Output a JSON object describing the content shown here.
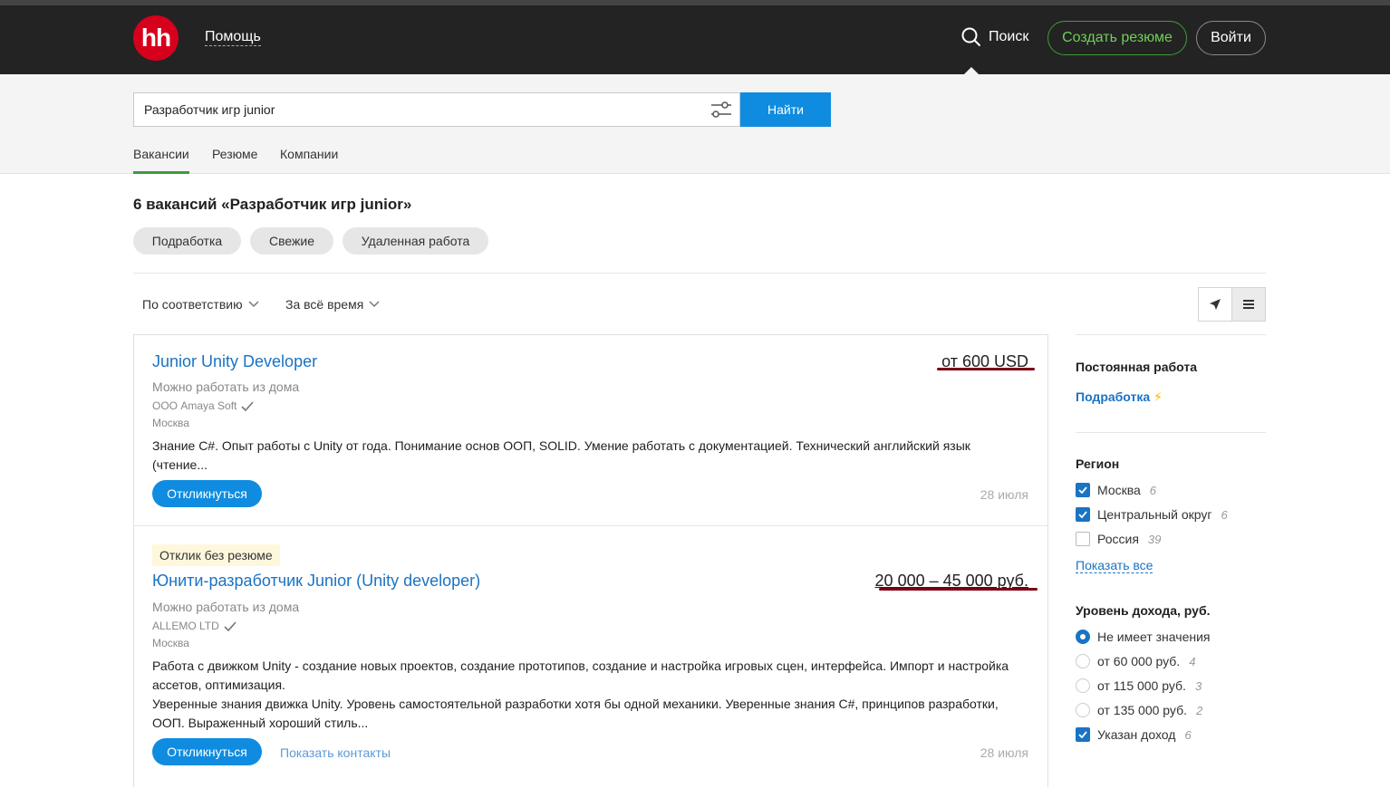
{
  "header": {
    "logo_text": "hh",
    "help": "Помощь",
    "search": "Поиск",
    "create_resume": "Создать резюме",
    "login": "Войти"
  },
  "search": {
    "query": "Разработчик игр junior",
    "find_button": "Найти",
    "tabs": [
      {
        "label": "Вакансии",
        "active": true
      },
      {
        "label": "Резюме",
        "active": false
      },
      {
        "label": "Компании",
        "active": false
      }
    ]
  },
  "results": {
    "title": "6 вакансий «Разработчик игр junior»",
    "chips": [
      "Подработка",
      "Свежие",
      "Удаленная работа"
    ],
    "sort_relevance": "По соответствию",
    "sort_time": "За всё время"
  },
  "vacancies": [
    {
      "title": "Junior Unity Developer",
      "salary": "от 600 USD",
      "remote": "Можно работать из дома",
      "company": "ООО Amaya Soft",
      "city": "Москва",
      "description": "Знание C#. Опыт работы с Unity от года. Понимание основ ООП, SOLID. Умение работать с документацией. Технический английский язык (чтение...",
      "respond": "Откликнуться",
      "date": "28 июля"
    },
    {
      "badge": "Отклик без резюме",
      "title": "Юнити-разработчик Junior (Unity developer)",
      "salary": "20 000 – 45 000 руб.",
      "remote": "Можно работать из дома",
      "company": "ALLEMO LTD",
      "city": "Москва",
      "description1": "Работа с движком Unity - создание новых проектов, создание прототипов, создание и настройка игровых сцен, интерфейса. Импорт и настройка ассетов, оптимизация.",
      "description2": "Уверенные знания движка Unity. Уровень самостоятельной разработки хотя бы одной механики. Уверенные знания C#, принципов разработки, ООП. Выраженный хороший стиль...",
      "respond": "Откликнуться",
      "show_contacts": "Показать контакты",
      "date": "28 июля"
    }
  ],
  "sidebar": {
    "employment_heading": "Постоянная работа",
    "part_time": "Подработка",
    "region_heading": "Регион",
    "regions": [
      {
        "label": "Москва",
        "count": "6",
        "checked": true
      },
      {
        "label": "Центральный округ",
        "count": "6",
        "checked": true
      },
      {
        "label": "Россия",
        "count": "39",
        "checked": false
      }
    ],
    "show_all": "Показать все",
    "income_heading": "Уровень дохода, руб.",
    "income": [
      {
        "label": "Не имеет значения",
        "count": "",
        "selected": true
      },
      {
        "label": "от 60 000 руб.",
        "count": "4",
        "selected": false
      },
      {
        "label": "от 115 000 руб.",
        "count": "3",
        "selected": false
      },
      {
        "label": "от 135 000 руб.",
        "count": "2",
        "selected": false
      }
    ],
    "income_specified": {
      "label": "Указан доход",
      "count": "6",
      "checked": true
    }
  },
  "colors": {
    "brand_red": "#d6001c",
    "link_blue": "#1a73c4",
    "button_blue": "#0f8ce0",
    "green": "#6fcf57",
    "salary_underline": "#7a0012"
  }
}
